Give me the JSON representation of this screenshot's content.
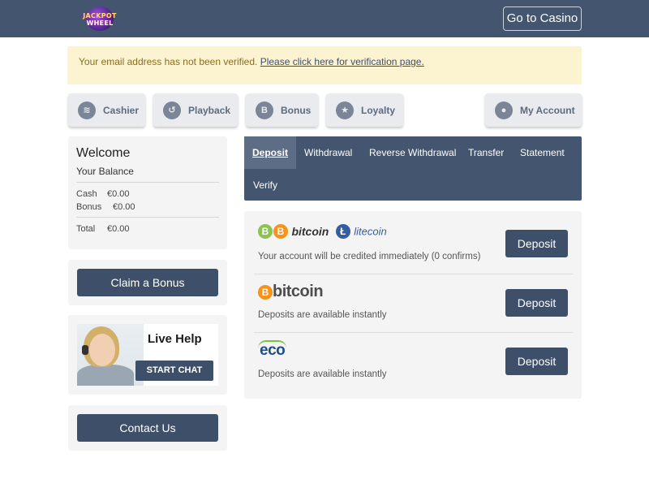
{
  "header": {
    "logo": {
      "line1": "JACKPOT",
      "line2": "WHEEL"
    },
    "go_casino_label": "Go to Casino"
  },
  "alert": {
    "message": "Your email address has not been verified. ",
    "link_text": "Please click here for verification page."
  },
  "nav": {
    "cashier": "Cashier",
    "playback": "Playback",
    "bonus": "Bonus",
    "loyalty": "Loyalty",
    "my_account": "My Account"
  },
  "welcome": {
    "title": "Welcome",
    "subtitle": "Your Balance",
    "cash_label": "Cash",
    "cash_value": "€0.00",
    "bonus_label": "Bonus",
    "bonus_value": "€0.00",
    "total_label": "Total",
    "total_value": "€0.00"
  },
  "claim_bonus_label": "Claim a Bonus",
  "live_help": {
    "title": "Live Help",
    "chat_label": "START CHAT"
  },
  "contact_label": "Contact Us",
  "tabs": {
    "deposit": "Deposit",
    "withdrawal": "Withdrawal",
    "reverse_withdrawal": "Reverse Withdrawal",
    "transfer": "Transfer",
    "statement": "Statement",
    "verify": "Verify"
  },
  "methods": [
    {
      "logo_b": "B",
      "logo_bitcoin": "bitcoin",
      "logo_l": "Ł",
      "logo_litecoin": "litecoin",
      "desc": "Your account will be credited immediately (0 confirms)",
      "button": "Deposit"
    },
    {
      "logo_b": "B",
      "logo_bitcoin": "bitcoin",
      "desc": "Deposits are available instantly",
      "button": "Deposit"
    },
    {
      "logo_eco": "eco",
      "desc": "Deposits are available instantly",
      "button": "Deposit"
    }
  ],
  "colors": {
    "header_bg": "#43556f",
    "button_dark": "#3e5069",
    "alert_bg": "#fcf3d0",
    "bitcoin_orange": "#f7931a",
    "bitcoin_green": "#8dc351",
    "litecoin_blue": "#345d9d"
  },
  "icons": {
    "cashier": "coins-icon",
    "playback": "playback-icon",
    "bonus": "bonus-b-icon",
    "loyalty": "star-badge-icon",
    "my_account": "user-icon"
  }
}
